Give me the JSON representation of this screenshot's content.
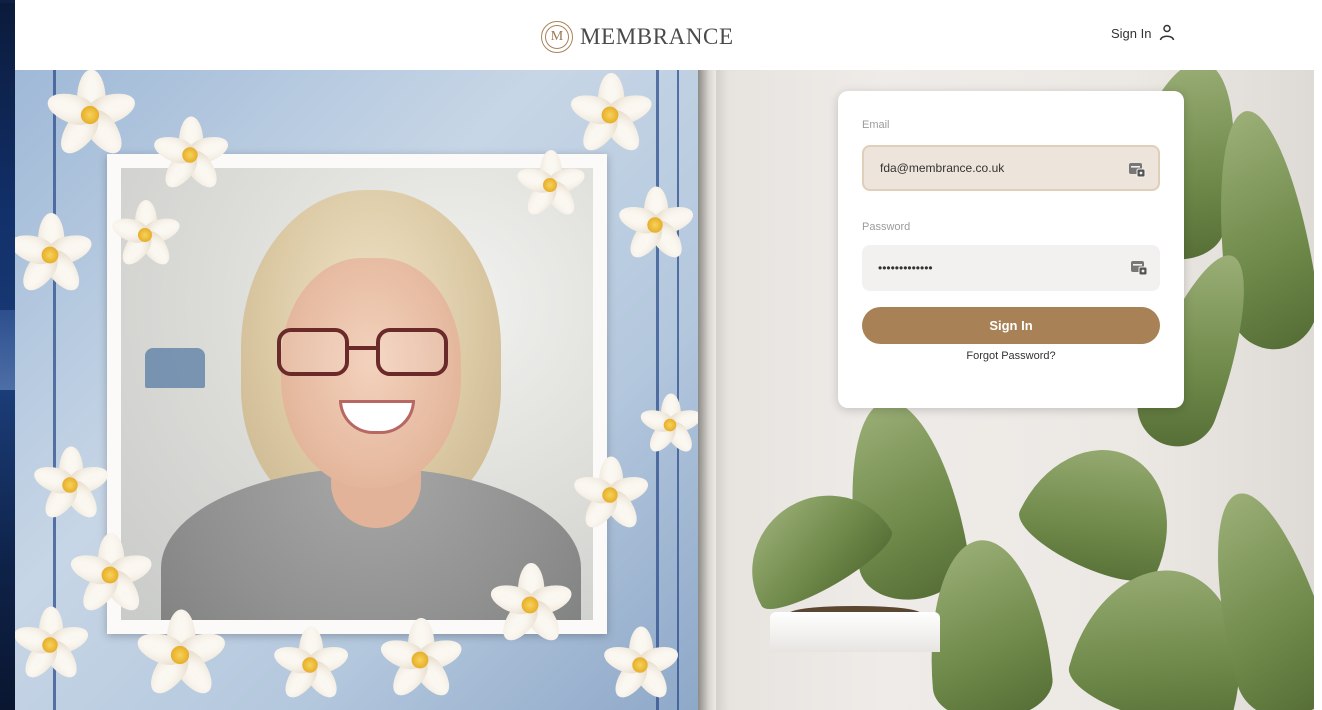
{
  "header": {
    "brand_name": "MEMBRANCE",
    "logo_letter": "M",
    "signin_label": "Sign In"
  },
  "login": {
    "email_label": "Email",
    "email_value": "fda@membrance.co.uk",
    "password_label": "Password",
    "password_value": "passwordvalue",
    "signin_button_label": "Sign In",
    "forgot_link_label": "Forgot Password?"
  },
  "colors": {
    "accent": "#a88256",
    "brand_text": "#4a4a4a"
  },
  "icons": {
    "header_user": "user-icon",
    "field_autofill": "password-manager-icon",
    "brand_logo": "monogram-m-logo"
  }
}
